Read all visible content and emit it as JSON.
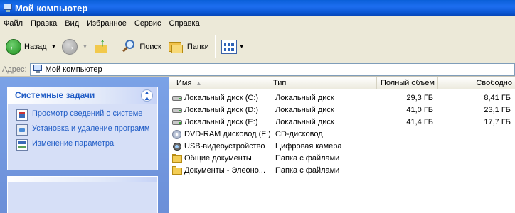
{
  "window": {
    "title": "Мой компьютер"
  },
  "menu": {
    "items": [
      "Файл",
      "Правка",
      "Вид",
      "Избранное",
      "Сервис",
      "Справка"
    ]
  },
  "toolbar": {
    "back_label": "Назад",
    "search_label": "Поиск",
    "folders_label": "Папки"
  },
  "address": {
    "label": "Адрес:",
    "value": "Мой компьютер"
  },
  "tasks": {
    "header": "Системные задачи",
    "items": [
      {
        "label": "Просмотр сведений о системе",
        "icon": "system-info-icon"
      },
      {
        "label": "Установка и удаление программ",
        "icon": "add-remove-programs-icon"
      },
      {
        "label": "Изменение параметра",
        "icon": "control-panel-icon"
      }
    ]
  },
  "list": {
    "columns": {
      "name": "Имя",
      "type": "Тип",
      "total": "Полный объем",
      "free": "Свободно"
    },
    "rows": [
      {
        "name": "Локальный диск (C:)",
        "type": "Локальный диск",
        "total": "29,3 ГБ",
        "free": "8,41 ГБ",
        "icon": "hard-disk-icon"
      },
      {
        "name": "Локальный диск (D:)",
        "type": "Локальный диск",
        "total": "41,0 ГБ",
        "free": "23,1 ГБ",
        "icon": "hard-disk-icon"
      },
      {
        "name": "Локальный диск (E:)",
        "type": "Локальный диск",
        "total": "41,4 ГБ",
        "free": "17,7 ГБ",
        "icon": "hard-disk-icon"
      },
      {
        "name": "DVD-RAM дисковод (F:)",
        "type": "CD-дисковод",
        "total": "",
        "free": "",
        "icon": "cd-drive-icon"
      },
      {
        "name": "USB-видеоустройство",
        "type": "Цифровая камера",
        "total": "",
        "free": "",
        "icon": "camera-icon"
      },
      {
        "name": "Общие документы",
        "type": "Папка с файлами",
        "total": "",
        "free": "",
        "icon": "folder-icon"
      },
      {
        "name": "Документы - Элеоно...",
        "type": "Папка с файлами",
        "total": "",
        "free": "",
        "icon": "folder-icon"
      }
    ]
  },
  "colors": {
    "title_bar": "#0a5fd8",
    "task_pane": "#7ba2e7",
    "task_link": "#215dc6"
  }
}
